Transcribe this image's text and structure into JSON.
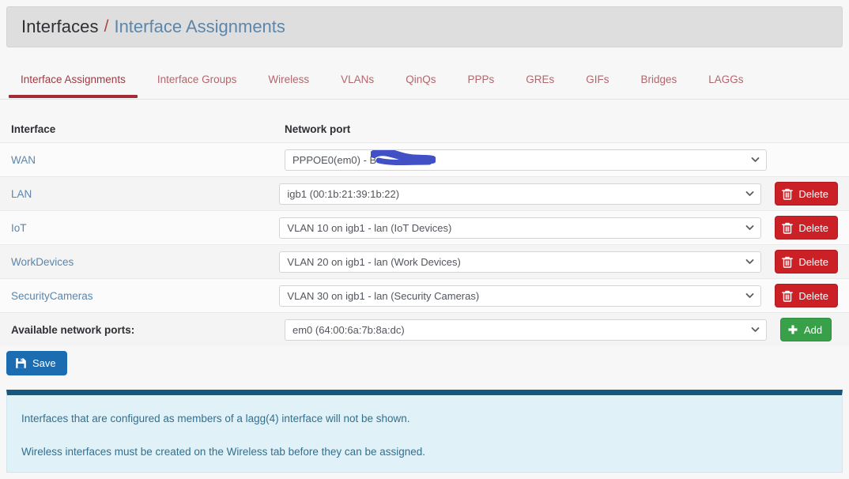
{
  "breadcrumb": {
    "root": "Interfaces",
    "separator": "/",
    "leaf": "Interface Assignments"
  },
  "tabs": [
    {
      "label": "Interface Assignments",
      "active": true
    },
    {
      "label": "Interface Groups",
      "active": false
    },
    {
      "label": "Wireless",
      "active": false
    },
    {
      "label": "VLANs",
      "active": false
    },
    {
      "label": "QinQs",
      "active": false
    },
    {
      "label": "PPPs",
      "active": false
    },
    {
      "label": "GREs",
      "active": false
    },
    {
      "label": "GIFs",
      "active": false
    },
    {
      "label": "Bridges",
      "active": false
    },
    {
      "label": "LAGGs",
      "active": false
    }
  ],
  "table": {
    "headers": {
      "interface": "Interface",
      "network_port": "Network port"
    },
    "rows": [
      {
        "interface": "WAN",
        "port_value": "PPPOE0(em0) - B",
        "redacted": true,
        "action": null
      },
      {
        "interface": "LAN",
        "port_value": "igb1 (00:1b:21:39:1b:22)",
        "redacted": false,
        "action": "Delete"
      },
      {
        "interface": "IoT",
        "port_value": "VLAN 10 on igb1 - lan (IoT Devices)",
        "redacted": false,
        "action": "Delete"
      },
      {
        "interface": "WorkDevices",
        "port_value": "VLAN 20 on igb1 - lan (Work Devices)",
        "redacted": false,
        "action": "Delete"
      },
      {
        "interface": "SecurityCameras",
        "port_value": "VLAN 30 on igb1 - lan (Security Cameras)",
        "redacted": false,
        "action": "Delete"
      }
    ],
    "available_ports": {
      "label": "Available network ports:",
      "port_value": "em0 (64:00:6a:7b:8a:dc)",
      "action": "Add"
    }
  },
  "buttons": {
    "save": "Save",
    "delete": "Delete",
    "add": "Add"
  },
  "icons": {
    "caret": "chevron-down-icon",
    "trash": "trash-icon",
    "plus": "plus-icon",
    "save": "floppy-disk-icon"
  },
  "info_panel": {
    "lines": [
      "Interfaces that are configured as members of a lagg(4) interface will not be shown.",
      "Wireless interfaces must be created on the Wireless tab before they can be assigned."
    ]
  },
  "colors": {
    "accent_red": "#a52a36",
    "link_blue": "#5c86aa",
    "delete_red": "#ca2026",
    "add_green": "#39a04a",
    "save_blue": "#1b6cb0",
    "info_bg": "#e0f1f8",
    "info_border": "#15577e",
    "redaction_blue": "#4150c4"
  }
}
